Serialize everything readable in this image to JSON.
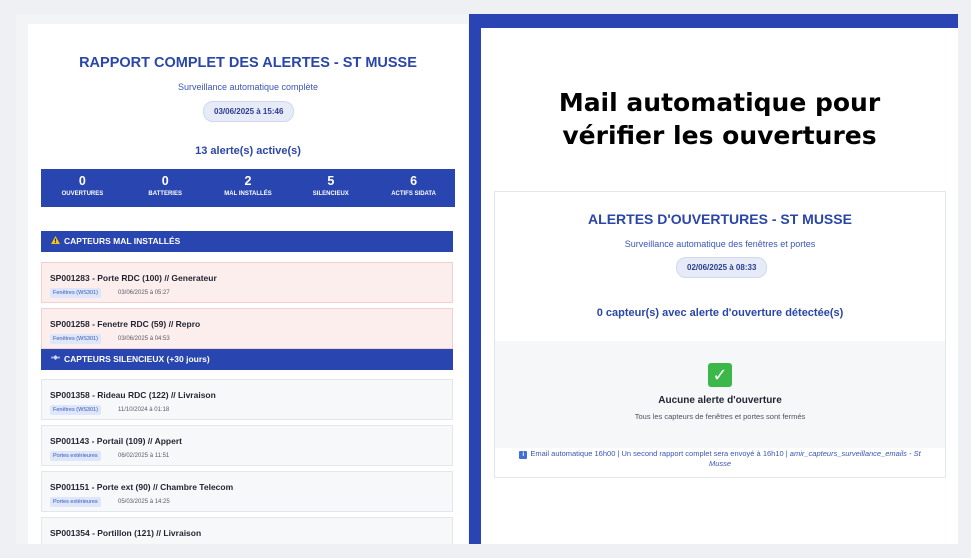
{
  "left": {
    "title": "RAPPORT COMPLET DES ALERTES - ST MUSSE",
    "subtitle": "Surveillance automatique complète",
    "date": "03/06/2025 à 15:46",
    "active_count": "13 alerte(s) active(s)",
    "stats": [
      {
        "value": "0",
        "label": "OUVERTURES"
      },
      {
        "value": "0",
        "label": "BATTERIES"
      },
      {
        "value": "2",
        "label": "MAL INSTALLÉS"
      },
      {
        "value": "5",
        "label": "SILENCIEUX"
      },
      {
        "value": "6",
        "label": "ACTIFS SIDATA"
      }
    ],
    "sections": [
      {
        "title": "CAPTEURS MAL INSTALLÉS",
        "icon": "warning-icon",
        "items": [
          {
            "title": "SP001283 - Porte RDC (100) // Generateur",
            "tag": "Fenêtres (WS301)",
            "date": "03/06/2025 à 05:27"
          },
          {
            "title": "SP001258 - Fenetre RDC (59) // Repro",
            "tag": "Fenêtres (WS301)",
            "date": "03/06/2025 à 04:53"
          }
        ]
      },
      {
        "title": "CAPTEURS SILENCIEUX (+30 jours)",
        "icon": "satellite-icon",
        "items": [
          {
            "title": "SP001358 - Rideau RDC (122) // Livraison",
            "tag": "Fenêtres (WS301)",
            "date": "11/10/2024 à 01:18"
          },
          {
            "title": "SP001143 - Portail (109) // Appert",
            "tag": "Portes extérieures",
            "date": "06/02/2025 à 11:51"
          },
          {
            "title": "SP001151 - Porte ext (90) // Chambre Telecom",
            "tag": "Portes extérieures",
            "date": "05/03/2025 à 14:25"
          },
          {
            "title": "SP001354 - Portillon (121) // Livraison",
            "tag": "",
            "date": ""
          }
        ]
      }
    ]
  },
  "right": {
    "banner_line1": "Mail automatique pour",
    "banner_line2": "vérifier les ouvertures",
    "title": "ALERTES D'OUVERTURES - ST MUSSE",
    "subtitle": "Surveillance automatique des fenêtres et portes",
    "date": "02/06/2025 à 08:33",
    "count": "0 capteur(s) avec alerte d'ouverture détectée(s)",
    "empty_icon": "check-mark-icon",
    "empty_title": "Aucune alerte d'ouverture",
    "empty_subtitle": "Tous les capteurs de fenêtres et portes sont fermés",
    "footer_text": "Email automatique 16h00 | Un second rapport complet sera envoyé à 16h10 | ",
    "footer_italic": "amir_capteurs_surveillance_emails - St Musse"
  },
  "colors": {
    "brand_blue": "#2845b0",
    "title_blue": "#2a46a8",
    "alert_bg": "#fdeeee",
    "success_green": "#3cb84a"
  }
}
